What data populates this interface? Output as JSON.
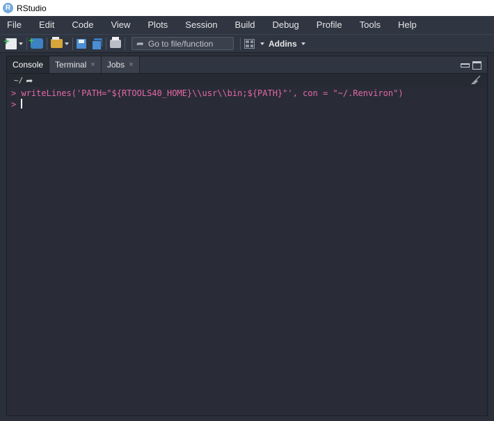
{
  "window": {
    "title": "RStudio",
    "logo_letter": "R"
  },
  "menu": [
    "File",
    "Edit",
    "Code",
    "View",
    "Plots",
    "Session",
    "Build",
    "Debug",
    "Profile",
    "Tools",
    "Help"
  ],
  "toolbar": {
    "goto_placeholder": "Go to file/function",
    "addins_label": "Addins"
  },
  "tabs": [
    {
      "label": "Console",
      "active": true,
      "closable": false
    },
    {
      "label": "Terminal",
      "active": false,
      "closable": true,
      "close_glyph": "×"
    },
    {
      "label": "Jobs",
      "active": false,
      "closable": true,
      "close_glyph": "×"
    }
  ],
  "console": {
    "working_dir": "~/",
    "prompt": ">",
    "lines": [
      {
        "prompt": ">",
        "text": "writeLines('PATH=\"${RTOOLS40_HOME}\\\\usr\\\\bin;${PATH}\"', con = \"~/.Renviron\")"
      },
      {
        "prompt": ">",
        "text": ""
      }
    ]
  },
  "colors": {
    "prompt": "#e468a8",
    "background": "#292c37",
    "chrome": "#2f3541"
  }
}
